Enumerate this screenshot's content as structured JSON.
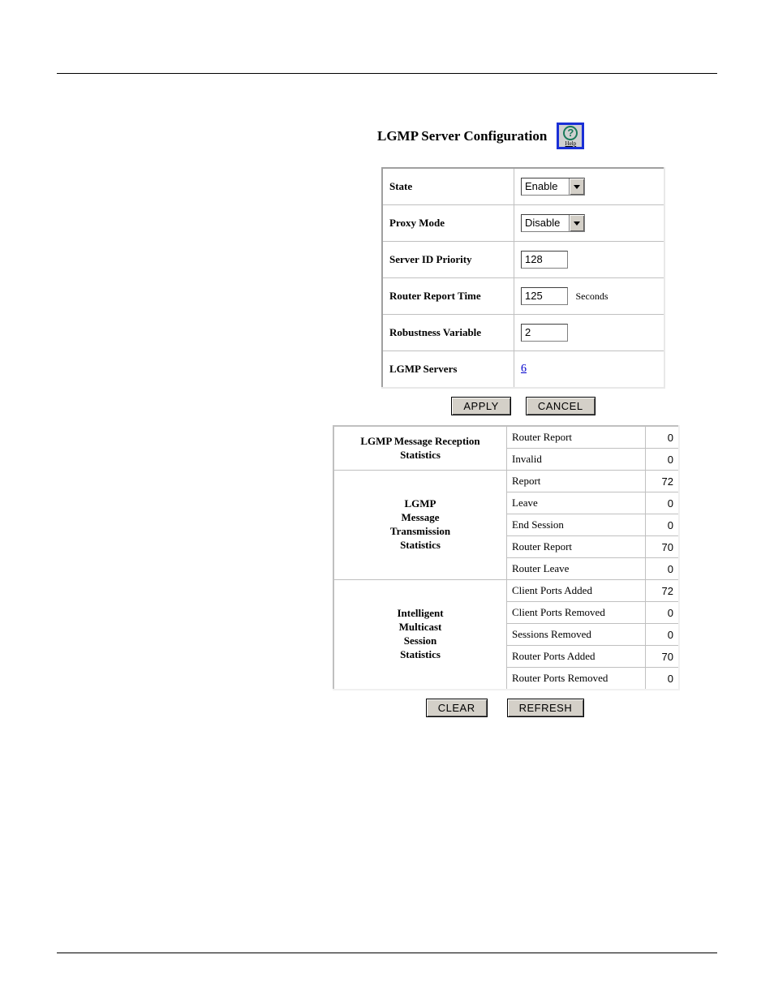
{
  "page_title": "LGMP Server Configuration",
  "help_icon": {
    "glyph": "?",
    "label": "Help"
  },
  "config": {
    "state": {
      "label": "State",
      "value": "Enable"
    },
    "proxy_mode": {
      "label": "Proxy Mode",
      "value": "Disable"
    },
    "server_id_priority": {
      "label": "Server ID Priority",
      "value": "128"
    },
    "router_report_time": {
      "label": "Router Report Time",
      "value": "125",
      "unit": "Seconds"
    },
    "robustness_variable": {
      "label": "Robustness Variable",
      "value": "2"
    },
    "lgmp_servers": {
      "label": "LGMP Servers",
      "value": "6"
    }
  },
  "buttons": {
    "apply": "APPLY",
    "cancel": "CANCEL",
    "clear": "CLEAR",
    "refresh": "REFRESH"
  },
  "stats": {
    "reception": {
      "header": "LGMP Message Reception Statistics",
      "rows": {
        "router_report": {
          "name": "Router Report",
          "value": "0"
        },
        "invalid": {
          "name": "Invalid",
          "value": "0"
        }
      }
    },
    "transmission": {
      "header_lines": [
        "LGMP",
        "Message",
        "Transmission",
        "Statistics"
      ],
      "rows": {
        "report": {
          "name": "Report",
          "value": "72"
        },
        "leave": {
          "name": "Leave",
          "value": "0"
        },
        "end_session": {
          "name": "End Session",
          "value": "0"
        },
        "router_report": {
          "name": "Router Report",
          "value": "70"
        },
        "router_leave": {
          "name": "Router Leave",
          "value": "0"
        }
      }
    },
    "intelligent": {
      "header_lines": [
        "Intelligent",
        "Multicast",
        "Session",
        "Statistics"
      ],
      "rows": {
        "client_ports_added": {
          "name": "Client Ports Added",
          "value": "72"
        },
        "client_ports_removed": {
          "name": "Client Ports Removed",
          "value": "0"
        },
        "sessions_removed": {
          "name": "Sessions Removed",
          "value": "0"
        },
        "router_ports_added": {
          "name": "Router Ports Added",
          "value": "70"
        },
        "router_ports_removed": {
          "name": "Router Ports Removed",
          "value": "0"
        }
      }
    }
  }
}
